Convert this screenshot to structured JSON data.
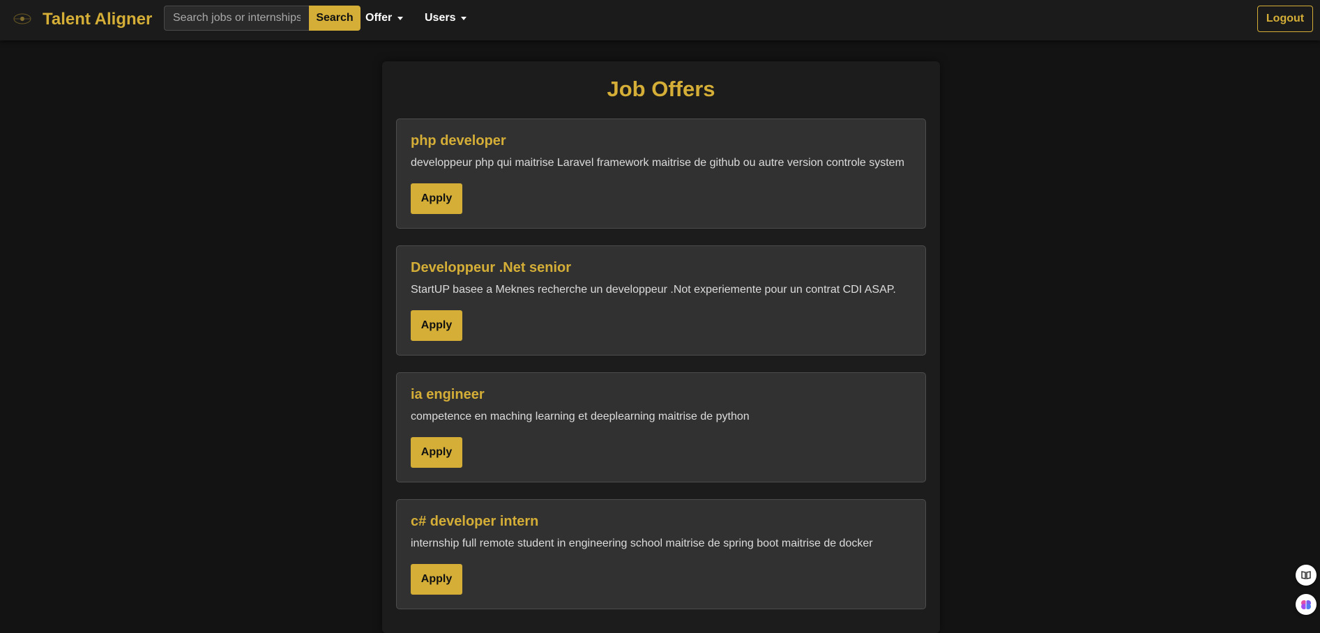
{
  "navbar": {
    "logo_icon": "brand-emblem-icon",
    "brand": "Talent Aligner",
    "search": {
      "placeholder": "Search jobs or internships",
      "value": "",
      "button_label": "Search"
    },
    "menus": [
      {
        "label": "Offer"
      },
      {
        "label": "Users"
      }
    ],
    "logout_label": "Logout"
  },
  "main": {
    "title": "Job Offers",
    "jobs": [
      {
        "title": "php developer",
        "description": "developpeur php qui maitrise Laravel framework maitrise de github ou autre version controle system",
        "apply_label": "Apply"
      },
      {
        "title": "Developpeur .Net senior",
        "description": "StartUP basee a Meknes recherche un developpeur .Not experiemente pour un contrat CDI ASAP.",
        "apply_label": "Apply"
      },
      {
        "title": "ia engineer",
        "description": "competence en maching learning et deeplearning maitrise de python",
        "apply_label": "Apply"
      },
      {
        "title": "c# developer intern",
        "description": "internship full remote student in engineering school maitrise de spring boot maitrise de docker",
        "apply_label": "Apply"
      }
    ]
  },
  "floating_buttons": [
    {
      "icon": "book-icon"
    },
    {
      "icon": "brain-icon"
    }
  ],
  "colors": {
    "accent": "#d4ae37",
    "background": "#131313",
    "navbar": "#1b1b1b",
    "panel": "#1c1c1c",
    "card": "#313131"
  }
}
